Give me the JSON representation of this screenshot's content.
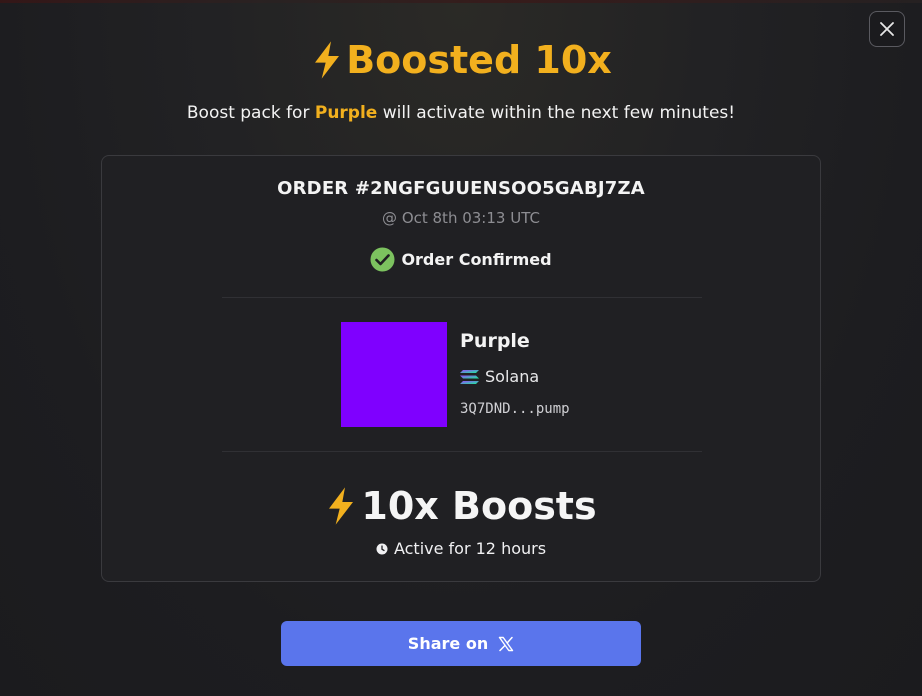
{
  "header": {
    "title": "Boosted 10x",
    "subtitle_prefix": "Boost pack for ",
    "subtitle_token": "Purple",
    "subtitle_suffix": " will activate within the next few minutes!"
  },
  "order": {
    "id_text": "ORDER #2NGFGUUENSOO5GABJ7ZA",
    "timestamp": "@ Oct 8th 03:13 UTC",
    "status": "Order Confirmed"
  },
  "token": {
    "name": "Purple",
    "chain": "Solana",
    "address": "3Q7DND...pump",
    "image_color": "#7f00ff"
  },
  "boost": {
    "label": "10x Boosts",
    "duration": "Active for 12 hours"
  },
  "actions": {
    "share_label": "Share on"
  },
  "colors": {
    "accent": "#f2b01e",
    "button": "#5a75ec",
    "confirmed": "#7cc25f"
  },
  "icons": {
    "close": "close-icon",
    "title_bolt": "lightning-icon",
    "check": "check-circle-icon",
    "chain": "solana-icon",
    "boost_bolt": "lightning-icon",
    "clock": "clock-icon",
    "x_logo": "x-logo-icon"
  }
}
